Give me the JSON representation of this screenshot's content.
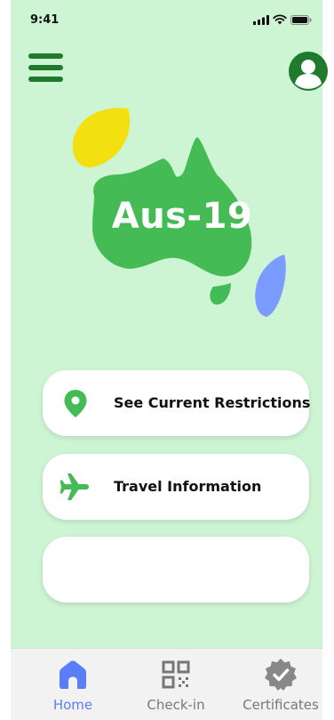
{
  "status_bar": {
    "time": "9:41"
  },
  "logo": {
    "text": "Aus-19"
  },
  "cards": [
    {
      "label": "See Current Restrictions",
      "icon": "location-pin-icon"
    },
    {
      "label": "Travel Information",
      "icon": "airplane-icon"
    },
    {
      "label": ""
    }
  ],
  "tab_bar": {
    "tabs": [
      {
        "label": "Home",
        "icon": "home-icon",
        "active": true
      },
      {
        "label": "Check-in",
        "icon": "qr-code-icon",
        "active": false
      },
      {
        "label": "Certificates",
        "icon": "verified-badge-icon",
        "active": false
      }
    ]
  },
  "colors": {
    "background": "#cdf4d3",
    "primary_green": "#45bb55",
    "dark_green": "#1f7a2e",
    "accent_blue": "#7a9bff",
    "accent_yellow": "#f2e011",
    "tab_active": "#5b7df8",
    "tab_inactive": "#777777"
  }
}
